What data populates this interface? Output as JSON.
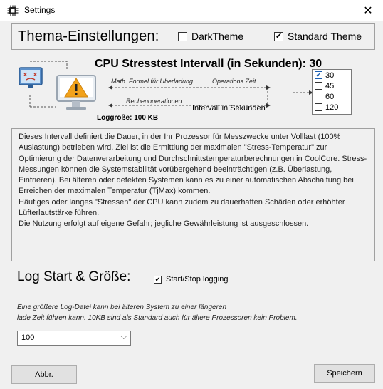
{
  "window": {
    "title": "Settings"
  },
  "theme": {
    "heading": "Thema-Einstellungen:",
    "options": [
      {
        "label": "DarkTheme",
        "checked": false
      },
      {
        "label": "Standard Theme",
        "checked": true
      }
    ]
  },
  "stresstest": {
    "title": "CPU Stresstest Intervall (in Sekunden): 30",
    "formula_label": "Math. Formel für Überladung",
    "operations_label": "Operations Zeit",
    "compute_label": "Rechenoperationen",
    "log_size": "Loggröße: 100 KB",
    "interval_label": "Intervall in Sekunden",
    "intervals": [
      {
        "label": "30",
        "checked": true
      },
      {
        "label": "45",
        "checked": false
      },
      {
        "label": "60",
        "checked": false
      },
      {
        "label": "120",
        "checked": false
      }
    ]
  },
  "description": "Dieses Intervall definiert die Dauer, in der Ihr Prozessor für Messzwecke unter Volllast (100% Auslastung) betrieben wird. Ziel ist die Ermittlung der maximalen \"Stress-Temperatur\" zur Optimierung der Datenverarbeitung und Durchschnittstemperaturberechnungen in CoolCore. Stress-Messungen können die Systemstabilität vorübergehend beeinträchtigen (z.B. Überlastung, Einfrieren). Bei älteren oder defekten Systemen kann es zu einer automatischen Abschaltung bei Erreichen der maximalen Temperatur (TjMax) kommen.\nHäufiges oder langes \"Stressen\" der CPU kann zudem zu dauerhaften Schäden oder erhöhter Lüfterlautstärke führen.\nDie Nutzung erfolgt auf eigene Gefahr; jegliche Gewährleistung ist ausgeschlossen.",
  "log": {
    "heading": "Log Start & Größe:",
    "toggle_label": "Start/Stop logging",
    "toggle_checked": true,
    "note_line1": "Eine größere Log-Datei kann bei älteren System zu einer längeren",
    "note_line2": "lade Zeit führen kann. 10KB sind als Standard auch für ältere Prozessoren kein Problem.",
    "size_value": "100"
  },
  "buttons": {
    "cancel": "Abbr.",
    "save": "Speichern"
  },
  "colors": {
    "accent": "#1a5fb4",
    "warning": "#f2a21b",
    "window_bg": "#f0f0f0"
  },
  "icons": {
    "app": "cpu-chip-icon",
    "close": "close-icon",
    "broken_monitor": "broken-monitor-icon",
    "warning_monitor": "monitor-warning-icon",
    "dropdown": "chevron-down-icon",
    "check": "check-icon"
  }
}
